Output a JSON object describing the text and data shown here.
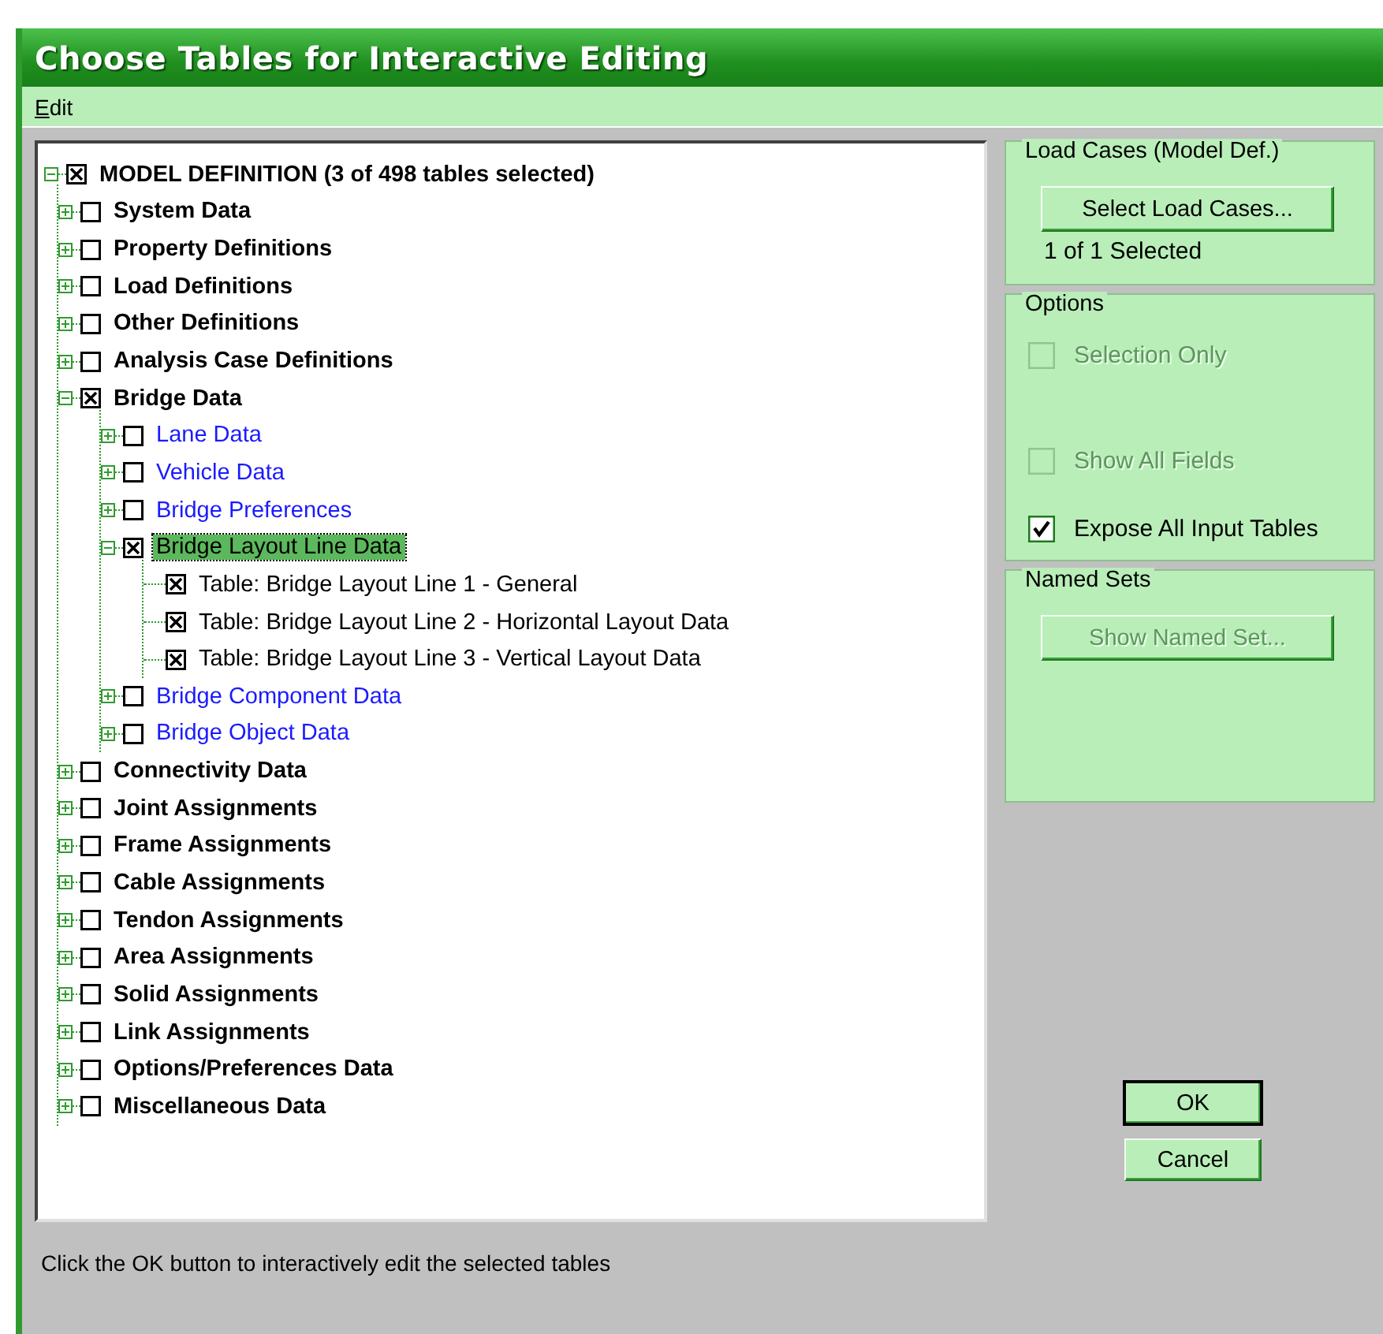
{
  "window": {
    "title": "Choose Tables for Interactive Editing"
  },
  "menu": [
    {
      "label": "Edit"
    }
  ],
  "tree": [
    {
      "kind": "root",
      "label": "MODEL DEFINITION  (3 of 498 tables selected)",
      "expanded": true,
      "checked": true,
      "selected": false,
      "children": [
        {
          "kind": "category",
          "label": "System Data",
          "expanded": false,
          "checked": false,
          "selected": false
        },
        {
          "kind": "category",
          "label": "Property Definitions",
          "expanded": false,
          "checked": false,
          "selected": false
        },
        {
          "kind": "category",
          "label": "Load Definitions",
          "expanded": false,
          "checked": false,
          "selected": false
        },
        {
          "kind": "category",
          "label": "Other Definitions",
          "expanded": false,
          "checked": false,
          "selected": false
        },
        {
          "kind": "category",
          "label": "Analysis Case Definitions",
          "expanded": false,
          "checked": false,
          "selected": false
        },
        {
          "kind": "category",
          "label": "Bridge Data",
          "expanded": true,
          "checked": true,
          "selected": false,
          "children": [
            {
              "kind": "group",
              "label": "Lane Data",
              "expanded": false,
              "checked": false,
              "selected": false
            },
            {
              "kind": "group",
              "label": "Vehicle Data",
              "expanded": false,
              "checked": false,
              "selected": false
            },
            {
              "kind": "group",
              "label": "Bridge Preferences",
              "expanded": false,
              "checked": false,
              "selected": false
            },
            {
              "kind": "group",
              "label": "Bridge Layout Line Data",
              "expanded": true,
              "checked": true,
              "selected": true,
              "children": [
                {
                  "kind": "table",
                  "label": "Table:  Bridge Layout Line 1 - General",
                  "checked": true,
                  "selected": false
                },
                {
                  "kind": "table",
                  "label": "Table:  Bridge Layout Line 2 - Horizontal Layout Data",
                  "checked": true,
                  "selected": false
                },
                {
                  "kind": "table",
                  "label": "Table:  Bridge Layout Line 3 - Vertical Layout Data",
                  "checked": true,
                  "selected": false
                }
              ]
            },
            {
              "kind": "group",
              "label": "Bridge Component Data",
              "expanded": false,
              "checked": false,
              "selected": false
            },
            {
              "kind": "group",
              "label": "Bridge Object Data",
              "expanded": false,
              "checked": false,
              "selected": false
            }
          ]
        },
        {
          "kind": "category",
          "label": "Connectivity Data",
          "expanded": false,
          "checked": false,
          "selected": false
        },
        {
          "kind": "category",
          "label": "Joint Assignments",
          "expanded": false,
          "checked": false,
          "selected": false
        },
        {
          "kind": "category",
          "label": "Frame Assignments",
          "expanded": false,
          "checked": false,
          "selected": false
        },
        {
          "kind": "category",
          "label": "Cable Assignments",
          "expanded": false,
          "checked": false,
          "selected": false
        },
        {
          "kind": "category",
          "label": "Tendon Assignments",
          "expanded": false,
          "checked": false,
          "selected": false
        },
        {
          "kind": "category",
          "label": "Area Assignments",
          "expanded": false,
          "checked": false,
          "selected": false
        },
        {
          "kind": "category",
          "label": "Solid Assignments",
          "expanded": false,
          "checked": false,
          "selected": false
        },
        {
          "kind": "category",
          "label": "Link Assignments",
          "expanded": false,
          "checked": false,
          "selected": false
        },
        {
          "kind": "category",
          "label": "Options/Preferences Data",
          "expanded": false,
          "checked": false,
          "selected": false
        },
        {
          "kind": "category",
          "label": "Miscellaneous Data",
          "expanded": false,
          "checked": false,
          "selected": false
        }
      ]
    }
  ],
  "load_cases": {
    "title": "Load Cases (Model Def.)",
    "button": {
      "label": "Select Load Cases...",
      "disabled": false
    },
    "status": "1 of 1 Selected"
  },
  "options": {
    "title": "Options",
    "items": [
      {
        "label": "Selection Only",
        "checked": false,
        "disabled": true
      },
      {
        "label": "Show All Fields",
        "checked": false,
        "disabled": true
      },
      {
        "label": "Expose All Input Tables",
        "checked": true,
        "disabled": false
      }
    ]
  },
  "named_sets": {
    "title": "Named Sets",
    "button": {
      "label": "Show Named Set...",
      "disabled": true
    }
  },
  "buttons": [
    {
      "label": "OK",
      "default": true
    },
    {
      "label": "Cancel",
      "default": false
    }
  ],
  "status_bar": "Click the OK button to interactively edit the selected tables"
}
